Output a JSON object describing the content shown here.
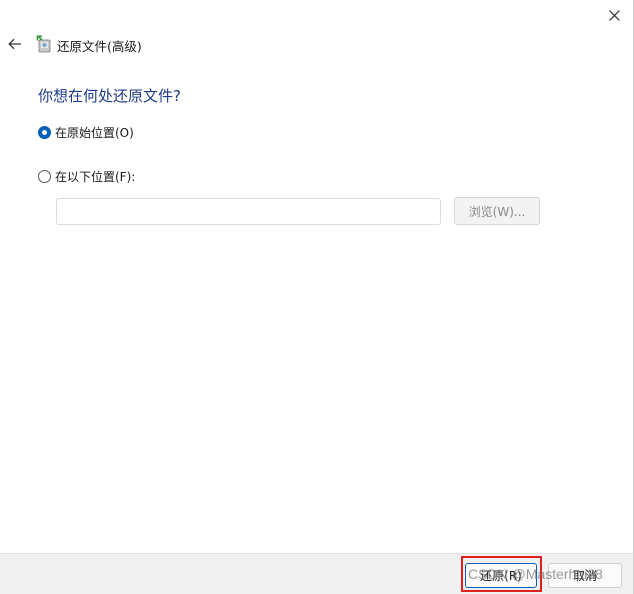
{
  "window": {
    "title": "还原文件(高级)"
  },
  "main": {
    "heading": "你想在何处还原文件?",
    "option_original": "在原始位置(O)",
    "option_custom": "在以下位置(F):",
    "path_value": "",
    "browse_label": "浏览(W)..."
  },
  "footer": {
    "restore_label": "还原(R)",
    "cancel_label": "取消"
  },
  "watermark": "CSDN @Masterhai88",
  "colors": {
    "heading": "#1e3a8a",
    "accent": "#005fb8",
    "highlight": "#e0201c"
  }
}
